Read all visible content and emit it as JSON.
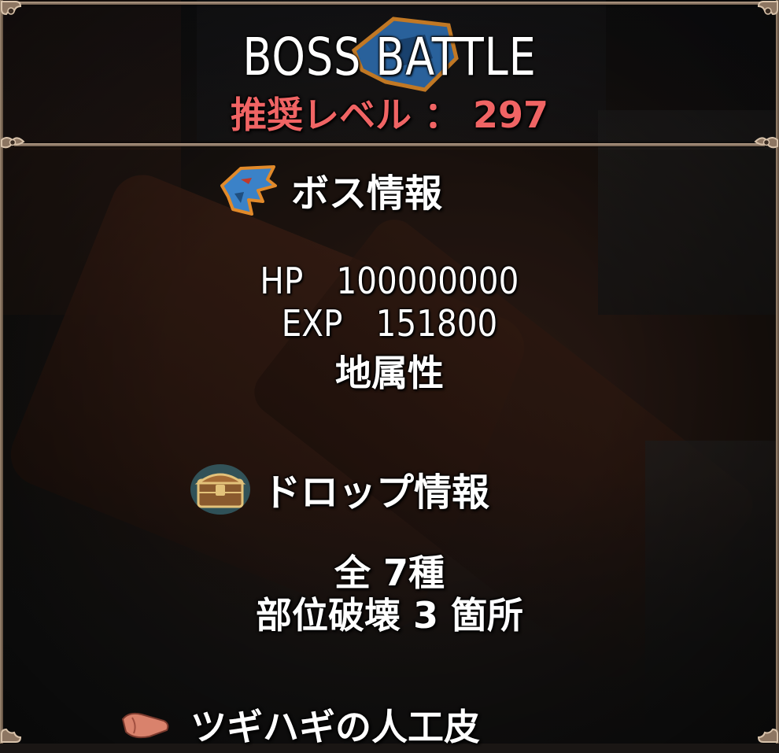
{
  "header": {
    "title": "BOSS BATTLE",
    "recommended_level_label": "推奨レベル ： 297"
  },
  "boss_info": {
    "heading": "ボス情報",
    "icon": "blue-beast-head-icon",
    "hp_label": "HP",
    "hp_value": "100000000",
    "exp_label": "EXP",
    "exp_value": "151800",
    "element": "地属性"
  },
  "drop_info": {
    "heading": "ドロップ情報",
    "icon": "treasure-chest-icon",
    "total_kinds": "全 7種",
    "part_break": "部位破壊 3 箇所"
  },
  "drop_list": [
    {
      "name": "ツギハギの人工皮",
      "icon": "patched-leather-icon"
    }
  ],
  "colors": {
    "recommended_level": "#f06464",
    "frame": "#b7a08a",
    "text": "#ffffff"
  }
}
